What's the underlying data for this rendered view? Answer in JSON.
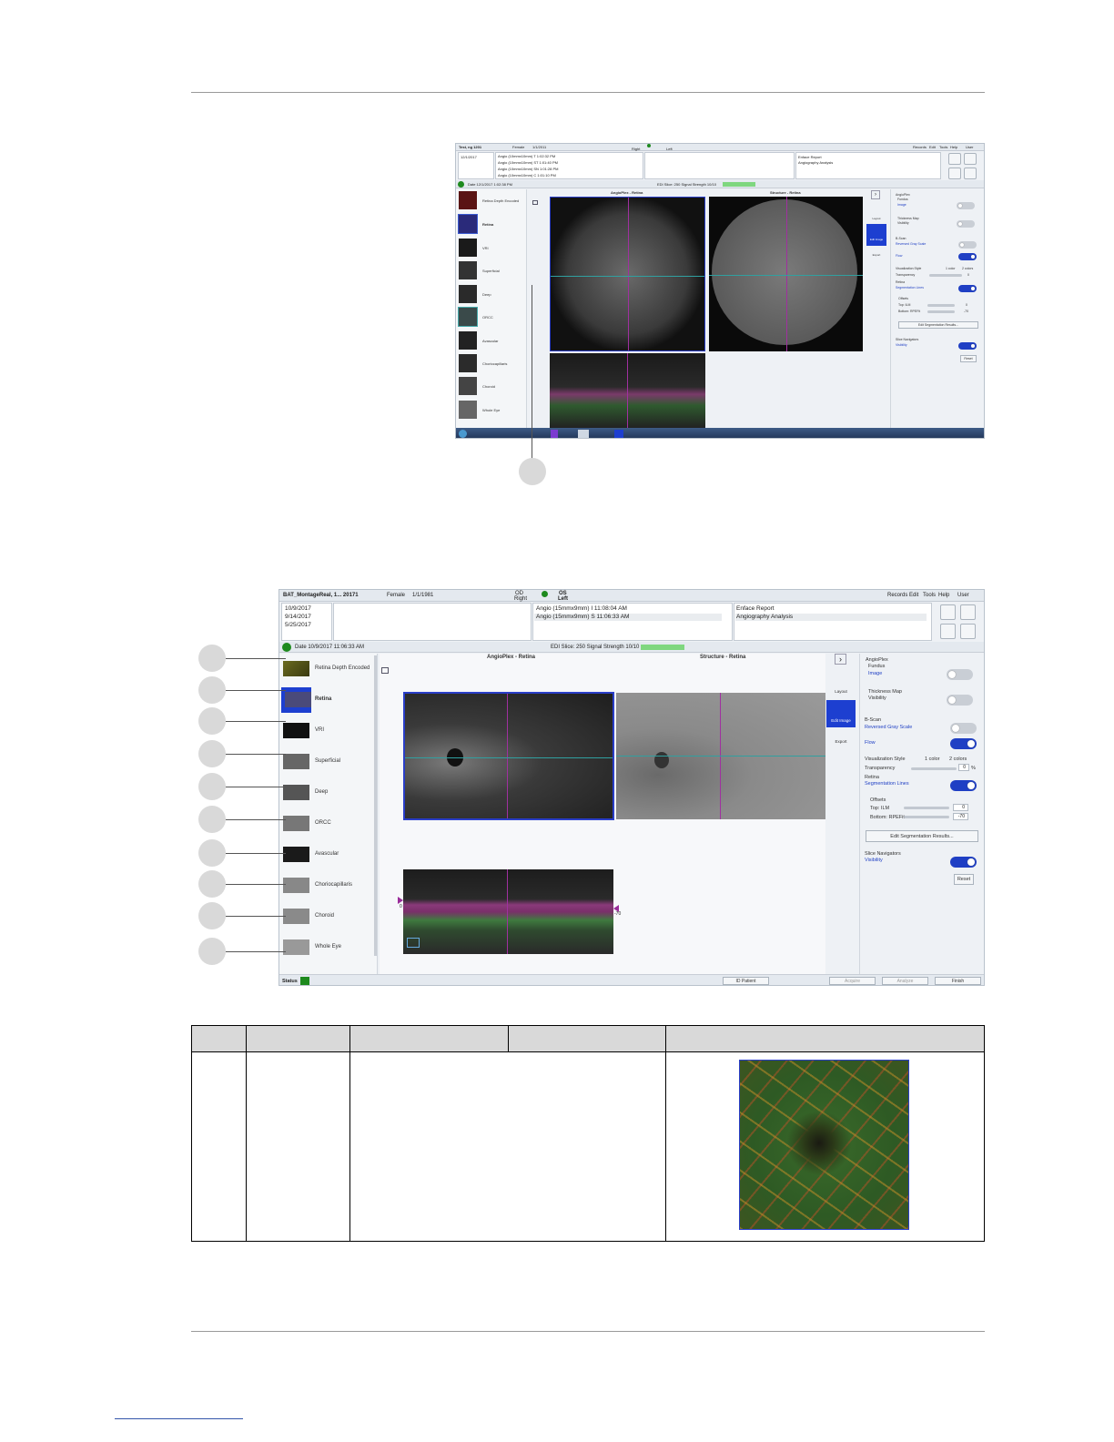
{
  "top_screenshot": {
    "menubar": {
      "patient": "Test, ng 1201",
      "sex": "Female",
      "dob": "1/1/2011",
      "eye_right": "Right",
      "eye_left": "Left",
      "menu": [
        "Records",
        "Edit",
        "Tools",
        "Help",
        "User"
      ]
    },
    "visit_dates": [
      "12/1/2017"
    ],
    "scans": [
      "Angio (10mmx10mm) T 1:02:32 PM",
      "Angio (10mmx10mm) ST 1:01:40 PM",
      "Angio (10mmx10mm) SN 1:01:28 PM",
      "Angio (10mmx10mm) C 1:01:10 PM"
    ],
    "reports": [
      "Enface Report",
      "Angiography Analysis"
    ],
    "strip_date": "Date 12/1/2017 1:02:38 PM",
    "strip_info": "EDI  Slice: 250  Signal Strength 10/10",
    "thumb_labels": [
      "Retina Depth Encoded",
      "Retina",
      "VRI",
      "Superficial",
      "Deep",
      "ORCC",
      "Avascular",
      "Choriocapillaris",
      "Choroid",
      "Whole Eye"
    ],
    "viewer_left_title": "AngioPlex - Retina",
    "viewer_right_title": "Structure - Retina",
    "tools": [
      "Layout",
      "Edit Image",
      "Export"
    ],
    "side": {
      "angioplex": "AngioPlex",
      "fundus": "Fundus",
      "image": "Image",
      "thickness": "Thickness Map",
      "visibility": "Visibility",
      "bscan": "B-Scan",
      "reversed": "Reversed Gray Scale",
      "flow": "Flow",
      "viz_style": "Visualization Style",
      "one_color": "1 color",
      "two_colors": "2 colors",
      "transparency": "Transparency",
      "transparency_val": "0",
      "retina": "Retina",
      "seg_lines": "Segmentation Lines",
      "offsets": "Offsets",
      "top_ilm": "Top: ILM",
      "top_val": "0",
      "bottom": "Bottom: RPEFit",
      "bottom_val": "-70",
      "edit_seg": "Edit Segmentation Results...",
      "slice_nav": "Slice Navigators",
      "slice_vis": "Visibility",
      "reset": "Reset"
    }
  },
  "bottom_screenshot": {
    "menubar": {
      "patient": "BAT_MontageReal, 1... 20171",
      "sex": "Female",
      "dob": "1/1/1981",
      "od": "OD",
      "od_sub": "Right",
      "os": "OS",
      "os_sub": "Left",
      "menu": [
        "Records",
        "Edit",
        "Tools",
        "Help",
        "User"
      ]
    },
    "visit_dates": [
      "10/9/2017",
      "9/14/2017",
      "5/25/2017"
    ],
    "scans": [
      "Angio (15mmx9mm) I 11:08:04 AM",
      "Angio (15mmx9mm) S 11:06:33 AM"
    ],
    "reports": [
      "Enface Report",
      "Angiography Analysis"
    ],
    "strip_date": "Date 10/9/2017 11:06:33 AM",
    "strip_info": "EDI  Slice: 250  Signal Strength 10/10",
    "thumb_labels": [
      "Retina Depth Encoded",
      "Retina",
      "VRI",
      "Superficial",
      "Deep",
      "ORCC",
      "Avascular",
      "Choriocapillaris",
      "Choroid",
      "Whole Eye"
    ],
    "viewer_left_title": "AngioPlex - Retina",
    "viewer_right_title": "Structure - Retina",
    "tools": [
      "Layout",
      "Edit Image",
      "Export"
    ],
    "side": {
      "angioplex": "AngioPlex",
      "fundus": "Fundus",
      "image": "Image",
      "thickness": "Thickness Map",
      "visibility": "Visibility",
      "bscan": "B-Scan",
      "reversed": "Reversed Gray Scale",
      "flow": "Flow",
      "viz_style": "Visualization Style",
      "one_color": "1 color",
      "two_colors": "2 colors",
      "transparency": "Transparency",
      "transparency_val": "0",
      "percent": "%",
      "retina": "Retina",
      "seg_lines": "Segmentation Lines",
      "offsets": "Offsets",
      "top_ilm": "Top: ILM",
      "top_val": "0",
      "bottom": "Bottom: RPEFit",
      "bottom_val": "-70",
      "edit_seg": "Edit Segmentation Results...",
      "slice_nav": "Slice Navigators",
      "slice_vis": "Visibility",
      "reset": "Reset"
    },
    "footer": {
      "status": "Status",
      "id_patient": "ID Patient",
      "acquire": "Acquire",
      "analyze": "Analyze",
      "finish": "Finish"
    },
    "bscan_left_marker": "0",
    "bscan_right_marker": "-70"
  },
  "colors": {
    "accent_blue": "#1f3fc4",
    "status_green": "#1e8a1e",
    "signal_green": "#7fd77f"
  }
}
